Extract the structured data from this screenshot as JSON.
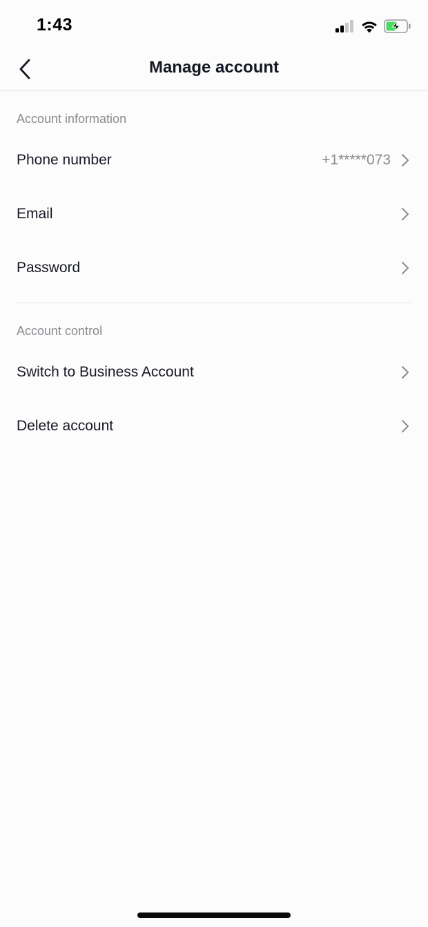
{
  "status_bar": {
    "time": "1:43",
    "icons": [
      "cellular-signal-icon",
      "wifi-icon",
      "battery-charging-icon"
    ],
    "battery_color": "#4cd964"
  },
  "nav": {
    "back_icon": "chevron-left-icon",
    "title": "Manage account"
  },
  "sections": {
    "account_information": {
      "header": "Account information",
      "phone_label": "Phone number",
      "phone_value": "+1*****073",
      "email_label": "Email",
      "password_label": "Password"
    },
    "account_control": {
      "header": "Account control",
      "business_label": "Switch to Business Account",
      "delete_label": "Delete account"
    }
  },
  "colors": {
    "background": "#fcfcfc",
    "primary_text": "#161823",
    "secondary_text": "#8a8b91"
  }
}
